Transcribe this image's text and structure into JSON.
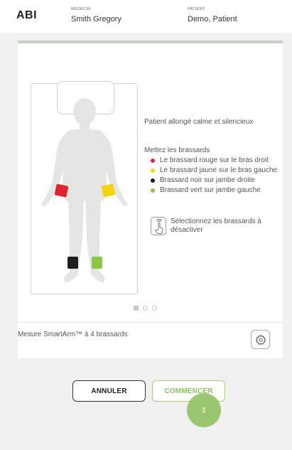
{
  "header": {
    "app_title": "ABI",
    "physician_caption": "MÉDECIN",
    "physician_name": "Smith Gregory",
    "patient_caption": "PATIENT",
    "patient_name": "Demo, Patient"
  },
  "instructions": {
    "position_text": "Patient allongé calme et silencieux",
    "cuffs_title": "Mettez les brassards",
    "cuffs": [
      {
        "label": "Le brassard rouge sur le bras droit",
        "color": "#e0242f"
      },
      {
        "label": "Le brassard jaune sur le bras gauche",
        "color": "#f5d20b"
      },
      {
        "label": "Brassard noir sur jambe droite",
        "color": "#1e1e1e"
      },
      {
        "label": "Brassard vert sur jambe gauche",
        "color": "#8dc63f"
      }
    ],
    "select_text": "Sélectionnez les brassards à désactiver"
  },
  "pager": {
    "current_page": 1,
    "page_count": 3
  },
  "footer": {
    "mode_label": "Mesure SmartArm™ à 4 brassards"
  },
  "buttons": {
    "cancel": "ANNULER",
    "start": "COMMENCER"
  },
  "callout": {
    "number": "1"
  },
  "colors": {
    "accent_green": "#8dc063",
    "card_bar": "#c7d1c5",
    "background": "#f0f0f0"
  },
  "icons": {
    "cuff_selection": "hand-touch-icon",
    "settings": "gear-icon"
  }
}
